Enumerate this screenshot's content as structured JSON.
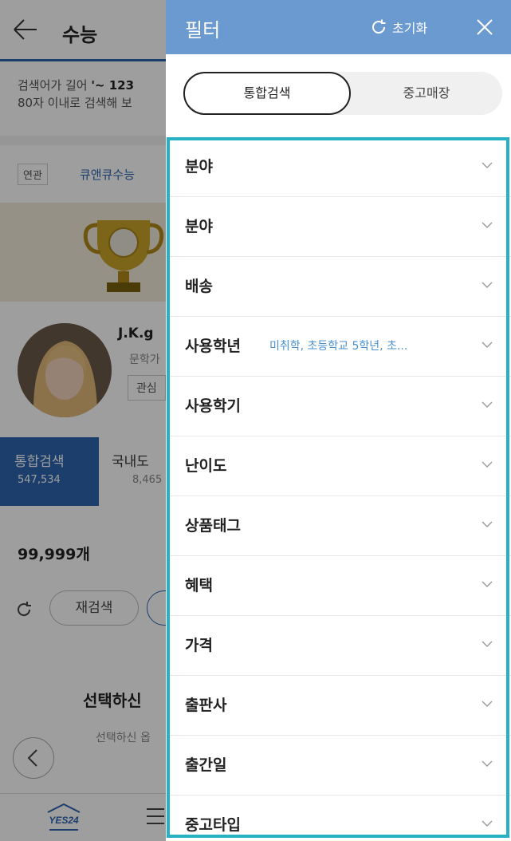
{
  "background": {
    "title": "수능",
    "notice_line1_prefix": "검색어가 길어 ",
    "notice_line1_bold": "'~ 123",
    "notice_line2": "80자 이내로 검색해 보",
    "related_tag": "연관",
    "related_link": "큐앤큐수능",
    "author_name": "J.K.g",
    "author_sub": "문학가",
    "author_button": "관심",
    "tab_active_label": "통합검색",
    "tab_active_count": "547,534",
    "tab2_label": "국내도",
    "tab2_count": "8,465",
    "result_count": "99,999개",
    "research_button": "재검색",
    "empty_title": "선택하신",
    "empty_desc": "선택하신 옵",
    "brand_logo": "YES24"
  },
  "filter": {
    "title": "필터",
    "reset_label": "초기화",
    "segment": {
      "active": "통합검색",
      "inactive": "중고매장"
    },
    "items": [
      {
        "label": "분야",
        "selected": ""
      },
      {
        "label": "분야",
        "selected": ""
      },
      {
        "label": "배송",
        "selected": ""
      },
      {
        "label": "사용학년",
        "selected": "미취학, 초등학교 5학년, 초..."
      },
      {
        "label": "사용학기",
        "selected": ""
      },
      {
        "label": "난이도",
        "selected": ""
      },
      {
        "label": "상품태그",
        "selected": ""
      },
      {
        "label": "혜택",
        "selected": ""
      },
      {
        "label": "가격",
        "selected": ""
      },
      {
        "label": "출판사",
        "selected": ""
      },
      {
        "label": "출간일",
        "selected": ""
      },
      {
        "label": "중고타입",
        "selected": ""
      }
    ]
  },
  "colors": {
    "panel_header": "#6b9ad0",
    "highlight": "#27b2c4",
    "selected_text": "#4a90d0",
    "brand_blue": "#2d64b0"
  }
}
